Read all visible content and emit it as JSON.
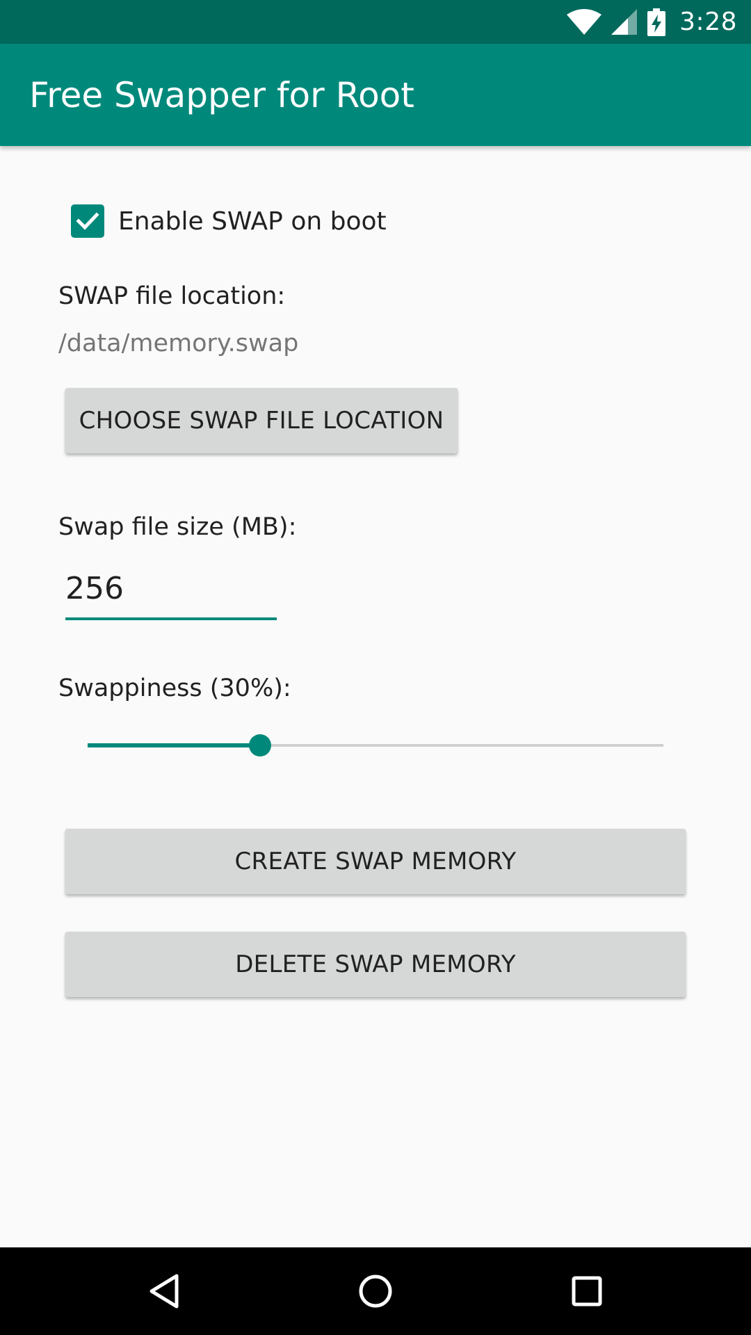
{
  "status_bar": {
    "time": "3:28",
    "icons": [
      "wifi-icon",
      "cell-signal-icon",
      "battery-charging-icon"
    ]
  },
  "app_bar": {
    "title": "Free Swapper for Root"
  },
  "settings": {
    "enable_on_boot_label": "Enable SWAP on boot",
    "enable_on_boot_checked": true,
    "file_location_label": "SWAP file location:",
    "file_location_value": "/data/memory.swap",
    "choose_location_button": "CHOOSE SWAP FILE LOCATION",
    "file_size_label": "Swap file size (MB):",
    "file_size_value": "256",
    "swappiness_label": "Swappiness (30%):",
    "swappiness_percent": 30
  },
  "actions": {
    "create_button": "CREATE SWAP MEMORY",
    "delete_button": "DELETE SWAP MEMORY"
  },
  "nav_bar": {
    "icons": [
      "back-icon",
      "home-icon",
      "recents-icon"
    ]
  },
  "colors": {
    "status_bar": "#00695c",
    "app_bar": "#00897b",
    "accent": "#00897b",
    "button": "#d6d7d7",
    "background": "#fafafa"
  }
}
